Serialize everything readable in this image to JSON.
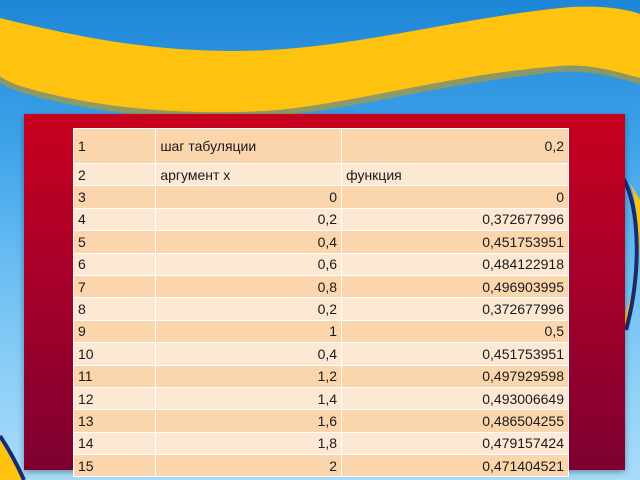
{
  "colors": {
    "background": "#3fa3ea",
    "banner": "#ffc20e",
    "panel": "#b0002a",
    "table_cell": "#fbd6ad",
    "table_cell_alt": "#fde8d4"
  },
  "table": {
    "rows": [
      {
        "n": "1",
        "b": "шаг табуляции",
        "c": "0,2"
      },
      {
        "n": "2",
        "b": "аргумент х",
        "c": "функция"
      },
      {
        "n": "3",
        "b": "0",
        "c": "0"
      },
      {
        "n": "4",
        "b": "0,2",
        "c": "0,372677996"
      },
      {
        "n": "5",
        "b": "0,4",
        "c": "0,451753951"
      },
      {
        "n": "6",
        "b": "0,6",
        "c": "0,484122918"
      },
      {
        "n": "7",
        "b": "0,8",
        "c": "0,496903995"
      },
      {
        "n": "8",
        "b": "0,2",
        "c": "0,372677996"
      },
      {
        "n": "9",
        "b": "1",
        "c": "0,5"
      },
      {
        "n": "10",
        "b": "0,4",
        "c": "0,451753951"
      },
      {
        "n": "11",
        "b": "1,2",
        "c": "0,497929598"
      },
      {
        "n": "12",
        "b": "1,4",
        "c": "0,493006649"
      },
      {
        "n": "13",
        "b": "1,6",
        "c": "0,486504255"
      },
      {
        "n": "14",
        "b": "1,8",
        "c": "0,479157424"
      },
      {
        "n": "15",
        "b": "2",
        "c": "0,471404521"
      }
    ]
  }
}
